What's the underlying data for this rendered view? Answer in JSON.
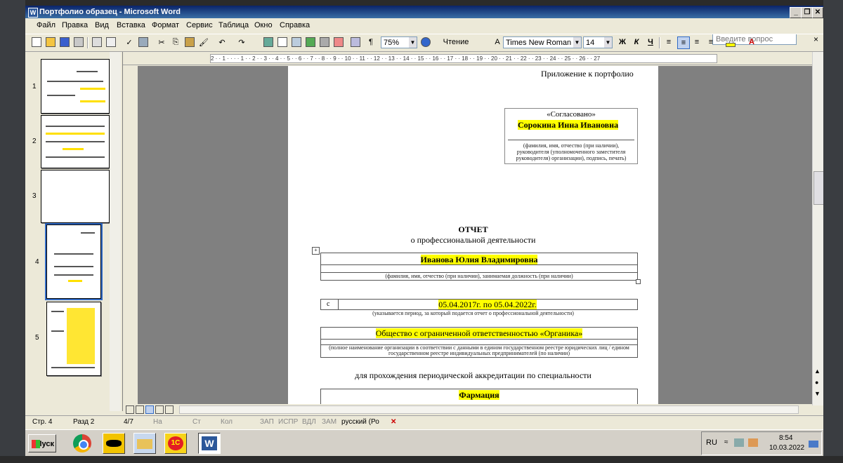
{
  "window": {
    "title": "Портфолио образец - Microsoft Word"
  },
  "menu": {
    "items": [
      "Файл",
      "Правка",
      "Вид",
      "Вставка",
      "Формат",
      "Сервис",
      "Таблица",
      "Окно",
      "Справка"
    ],
    "help_placeholder": "Введите вопрос"
  },
  "toolbar": {
    "zoom": "75%",
    "read_mode": "Чтение",
    "font": "Times New Roman",
    "font_size": "14",
    "bold": "Ж",
    "italic": "К",
    "underline": "Ч"
  },
  "thumbnails": {
    "numbers": [
      "1",
      "2",
      "3",
      "4",
      "5"
    ]
  },
  "ruler": {
    "ticks": "2 · · 1 · · · · 1 · · 2 · · 3 · · 4 · · 5 · · 6 · · 7 · · 8 · · 9 · · 10 · · 11 · · 12 · · 13 · · 14 · · 15 · · 16 · · 17 · · 18 · · 19 · · 20 · · 21 · · 22 · · 23 · · 24 · · 25 · · 26 · · 27"
  },
  "document": {
    "appendix": "Приложение к портфолио",
    "agreed": "«Согласовано»",
    "approver_name": "Сорокина Инна Ивановна",
    "approver_caption": "(фамилия, имя, отчество (при наличии), руководителя (уполномоченного заместителя руководителя) организации), подпись, печать)",
    "report_title": "ОТЧЕТ",
    "report_subtitle": "о профессиональной деятельности",
    "person_name": "Иванова Юлия Владимировна",
    "person_caption": "(фамилия, имя, отчество (при наличии), занимаемая должность (при наличии)",
    "period_prefix": "с",
    "period": "05.04.2017г. по 05.04.2022г.",
    "period_caption": "(указывается период, за который подается отчет о профессиональной деятельности)",
    "organization": "Общество с ограниченной ответственностью «Органика»",
    "organization_caption": "(полное наименование организации в соответствии с данными в едином государственном реестре юридических лиц / едином государственном реестре индивидуальных предпринимателей (по наличии)",
    "accreditation": "для прохождения периодической аккредитации по специальности",
    "specialty": "Фармация"
  },
  "status": {
    "page": "Стр. 4",
    "section": "Разд 2",
    "pages": "4/7",
    "at": "На",
    "line": "Ст",
    "col": "Кол",
    "rec": "ЗАП",
    "trk": "ИСПР",
    "ext": "ВДЛ",
    "ovr": "ЗАМ",
    "lang": "русский (Ро"
  },
  "taskbar": {
    "start": "Пуск",
    "lang": "RU",
    "time": "8:54",
    "date": "10.03.2022"
  },
  "colors": {
    "titlebar": "#0a246a",
    "highlight": "#ffff00",
    "chrome": "#ece9d8"
  }
}
